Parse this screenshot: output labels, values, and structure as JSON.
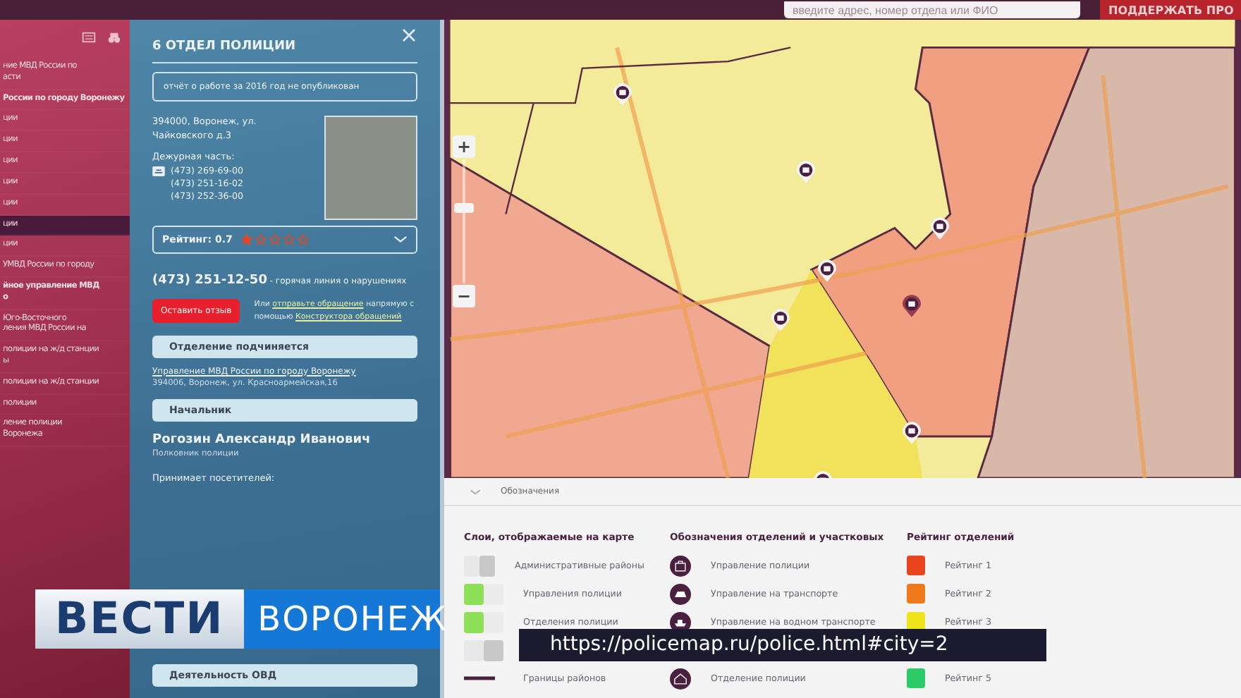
{
  "top_bar": {
    "search": {
      "placeholder": "введите адрес, номер отдела или ФИО"
    },
    "support_button": "ПОДДЕРЖАТЬ ПРО"
  },
  "sidebar": {
    "items": [
      {
        "label": "ние МВД России по\nасти",
        "kind": "item",
        "selected": false
      },
      {
        "label": "России по городу Воронежу",
        "kind": "header",
        "selected": false
      },
      {
        "label": "ции",
        "kind": "item",
        "selected": false
      },
      {
        "label": "ции",
        "kind": "item",
        "selected": false
      },
      {
        "label": "ции",
        "kind": "item",
        "selected": false
      },
      {
        "label": "ции",
        "kind": "item",
        "selected": false
      },
      {
        "label": "ции",
        "kind": "item",
        "selected": false
      },
      {
        "label": "ции",
        "kind": "item",
        "selected": true
      },
      {
        "label": "ции",
        "kind": "item",
        "selected": false
      },
      {
        "label": "УМВД России по городу",
        "kind": "item",
        "selected": false
      },
      {
        "label": "йное управление МВД\nо",
        "kind": "header",
        "selected": false
      },
      {
        "label": "Юго-Восточного\nления МВД России на",
        "kind": "item",
        "selected": false
      },
      {
        "label": "полиции на ж/д станции\nы",
        "kind": "item",
        "selected": false
      },
      {
        "label": "полиции на ж/д станции",
        "kind": "item",
        "selected": false
      },
      {
        "label": "полиции",
        "kind": "item",
        "selected": false
      },
      {
        "label": "ление полиции\nВоронежа",
        "kind": "item",
        "selected": false
      }
    ]
  },
  "panel": {
    "title": "6 ОТДЕЛ ПОЛИЦИИ",
    "notice": "отчёт о работе за 2016 год не опубликован",
    "address": "394000, Воронеж, ул. Чайковского д.3",
    "duty_label": "Дежурная часть:",
    "phones": [
      "(473) 269-69-00",
      "(473) 251-16-02",
      "(473) 252-36-00"
    ],
    "rating": {
      "label": "Рейтинг: 0.7",
      "stars": 1
    },
    "hotline": {
      "number": "(473) 251-12-50",
      "text": " - горячая линия о нарушениях"
    },
    "feedback_button": "Оставить отзыв",
    "appeal_text": [
      "Или ",
      "отправьте обращение",
      " напрямую с помощью ",
      "Конструктора обращений"
    ],
    "sections": [
      {
        "heading": "Отделение подчиняется",
        "link": "Управление МВД России по городу Воронежу",
        "note": "394006, Воронеж, ул. Красноармейская,16"
      },
      {
        "heading": "Начальник",
        "name": "Рогозин Александр Иванович",
        "note": "Полковник полиции",
        "extra": "Принимает посетителей:"
      },
      {
        "heading": "Деятельность ОВД"
      }
    ]
  },
  "map": {
    "zoom_in": "+",
    "zoom_out": "−",
    "zoom": {
      "level": 0.65
    }
  },
  "legend": {
    "toggle_label": "Обозначения",
    "columns": [
      {
        "title": "Слои, отображаемые на карте",
        "kind": "toggle",
        "items": [
          {
            "label": "Административные районы",
            "on": false
          },
          {
            "label": "Управления полиции",
            "on": true
          },
          {
            "label": "Отделения полиции",
            "on": true
          },
          {
            "on": false
          },
          {
            "label": "Границы районов",
            "kind": "line"
          }
        ]
      },
      {
        "title": "Обозначения отделений и участковых",
        "kind": "icon",
        "items": [
          {
            "label": "Управление полиции"
          },
          {
            "label": "Управление на транспорте"
          },
          {
            "label": "Управление на водном транспорте"
          },
          {
            "label": "Отделение полиции"
          }
        ]
      },
      {
        "title": "Рейтинг отделений",
        "kind": "swatch",
        "items": [
          {
            "label": "Рейтинг 1",
            "color": "#e8451e"
          },
          {
            "label": "Рейтинг 2",
            "color": "#ef7a1c"
          },
          {
            "label": "Рейтинг 3",
            "color": "#eee41c"
          },
          {
            "label": "Рейтинг 5",
            "color": "#2ecb6a"
          }
        ]
      }
    ]
  },
  "overlays": {
    "logo": [
      "ВЕСТИ",
      "ВОРОНЕЖ"
    ],
    "url_caption": "https://policemap.ru/police.html#city=2"
  }
}
